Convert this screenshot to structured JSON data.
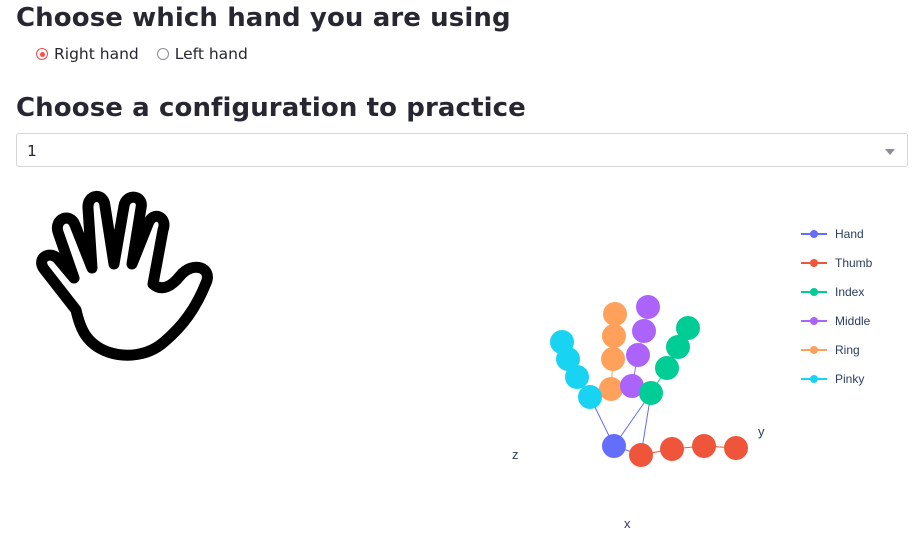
{
  "section_hand": {
    "title": "Choose which hand you are using",
    "options": [
      {
        "label": "Right hand",
        "selected": true
      },
      {
        "label": "Left hand",
        "selected": false
      }
    ]
  },
  "section_config": {
    "title": "Choose a configuration to practice",
    "select_value": "1"
  },
  "hand_image_icon": "open-hand-icon",
  "colors": {
    "accent": "#ff4b4b",
    "Hand": "#636efa",
    "Thumb": "#ef553b",
    "Index": "#00cc96",
    "Middle": "#ab63fa",
    "Ring": "#ffa15a",
    "Pinky": "#19d3f3"
  },
  "chart_data": {
    "type": "scatter3d",
    "axis_labels": {
      "x": "x",
      "y": "y",
      "z": "z"
    },
    "legend": [
      "Hand",
      "Thumb",
      "Index",
      "Middle",
      "Ring",
      "Pinky"
    ],
    "legend_placement": "top-right",
    "grid": false
  }
}
